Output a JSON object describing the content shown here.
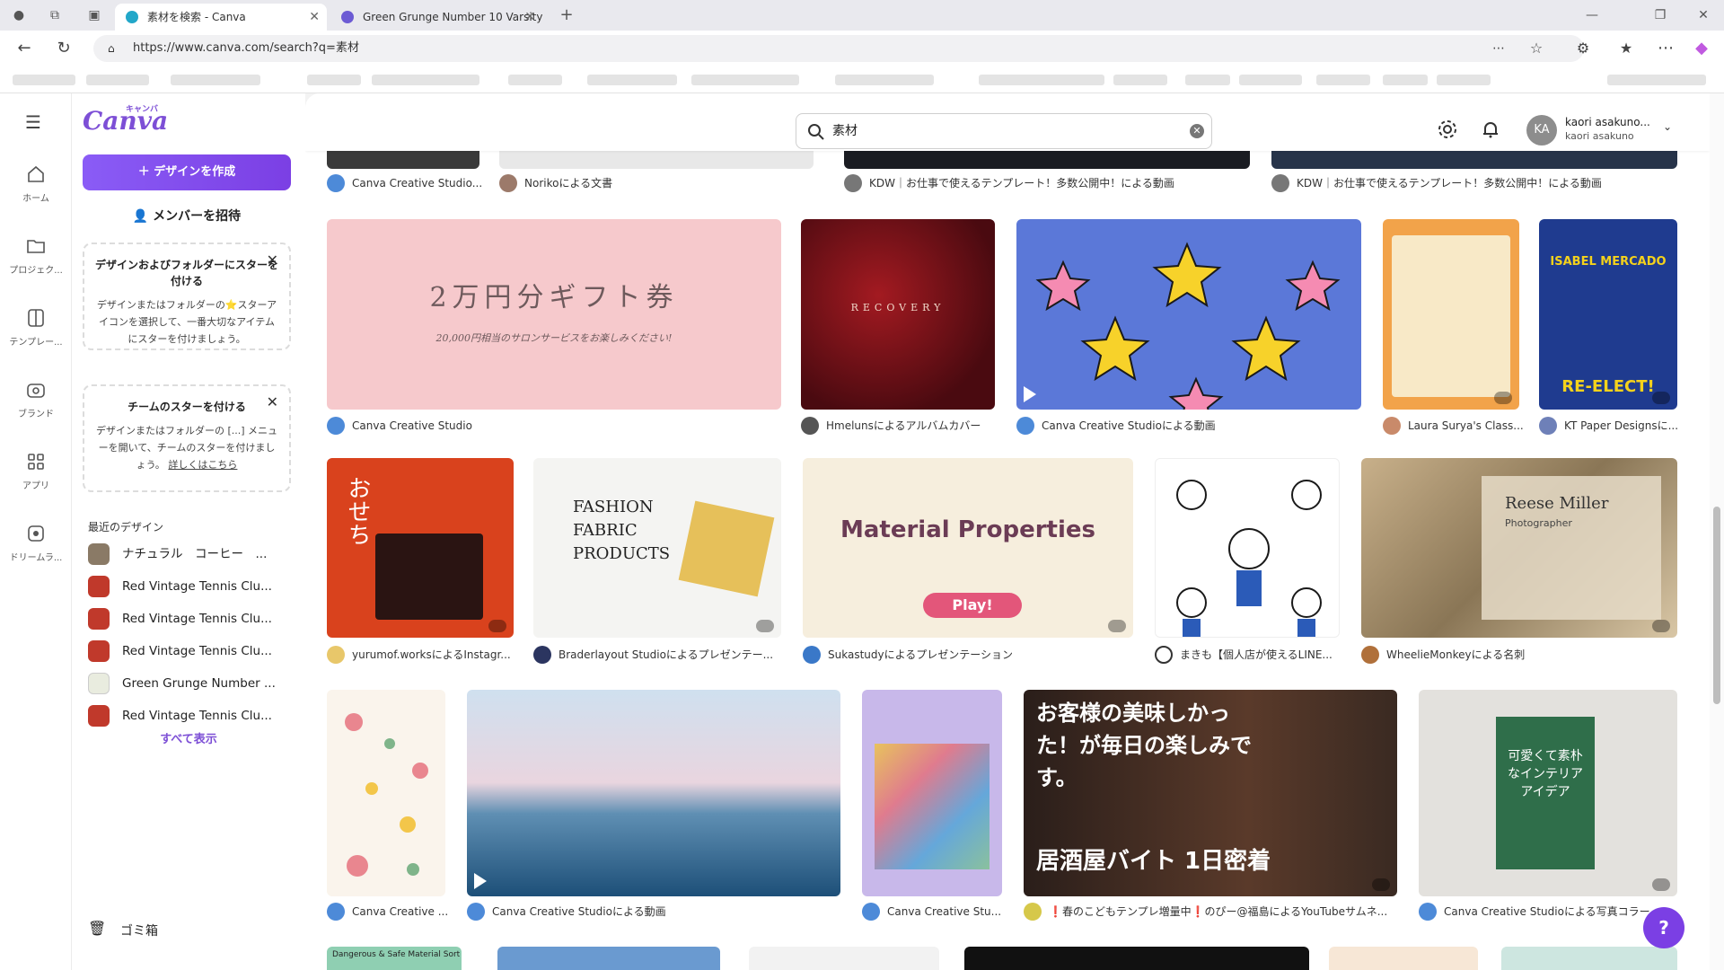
{
  "browser": {
    "tabs": [
      {
        "title": "素材を検索 - Canva",
        "active": true
      },
      {
        "title": "Green Grunge Number 10 Varsity",
        "active": false
      }
    ],
    "url": "https://www.canva.com/search?q=素材"
  },
  "rail": {
    "items": [
      {
        "label": "ホーム",
        "icon": "home-icon"
      },
      {
        "label": "プロジェク...",
        "icon": "folder-icon"
      },
      {
        "label": "テンプレー...",
        "icon": "template-icon"
      },
      {
        "label": "ブランド",
        "icon": "brand-icon"
      },
      {
        "label": "アプリ",
        "icon": "apps-icon"
      },
      {
        "label": "ドリームラ...",
        "icon": "dream-lab-icon"
      }
    ]
  },
  "panel": {
    "logo": "Canva",
    "logo_kana": "キャンバ",
    "create_button": "＋ デザインを作成",
    "invite_button": "メンバーを招待",
    "star_card": {
      "title": "デザインおよびフォルダーにスターを付ける",
      "body": "デザインまたはフォルダーの⭐スターアイコンを選択して、一番大切なアイテムにスターを付けましょう。"
    },
    "team_card": {
      "title": "チームのスターを付ける",
      "body": "デザインまたはフォルダーの [...] メニューを開いて、チームのスターを付けましょう。",
      "link": "詳しくはこちら"
    },
    "recent_title": "最近のデザイン",
    "recent": [
      "ナチュラル　コーヒー　...",
      "Red Vintage Tennis Clu...",
      "Red Vintage Tennis Clu...",
      "Red Vintage Tennis Clu...",
      "Green Grunge Number ...",
      "Red Vintage Tennis Clu..."
    ],
    "see_all": "すべて表示",
    "trash": "ゴミ箱"
  },
  "header": {
    "search_value": "素材",
    "user_name": "kaori asakuno...",
    "user_sub": "kaori asakuno",
    "avatar_initials": "KA"
  },
  "results": {
    "row0_captions": [
      "Canva Creative Studio...",
      "Norikoによる文書",
      "KDW｜お仕事で使えるテンプレート！多数公開中！による動画",
      "KDW｜お仕事で使えるテンプレート！多数公開中！による動画"
    ],
    "row1": [
      {
        "caption": "Canva Creative Studio",
        "text": "2万円分ギフト券",
        "sub": "20,000円相当のサロンサービスをお楽しみください!"
      },
      {
        "caption": "Hmelunsによるアルバムカバー",
        "text": "RECOVERY"
      },
      {
        "caption": "Canva Creative Studioによる動画"
      },
      {
        "caption": "Laura Surya's Class..."
      },
      {
        "caption": "KT Paper Designsに...",
        "text": "ISABEL MERCADO",
        "sub": "RE-ELECT!"
      }
    ],
    "row2": [
      {
        "caption": "yurumof.worksによるInstagr...",
        "text": "おせち"
      },
      {
        "caption": "Braderlayout Studioによるプレゼンテー...",
        "text": "FASHION FABRIC PRODUCTS"
      },
      {
        "caption": "Sukastudyによるプレゼンテーション",
        "text": "Material Properties",
        "sub": "Play!"
      },
      {
        "caption": "まきも【個人店が使えるLINE..."
      },
      {
        "caption": "WheelieMonkeyによる名刺",
        "text": "Reese Miller",
        "sub": "Photographer"
      }
    ],
    "row3": [
      {
        "caption": "Canva Creative ..."
      },
      {
        "caption": "Canva Creative Studioによる動画"
      },
      {
        "caption": "Canva Creative Stu..."
      },
      {
        "caption": "❗春のこどもテンプレ増量中❗のぴー@福島によるYouTubeサムネ...",
        "text": "お客様の美味しかった！が毎日の楽しみです。",
        "sub": "居酒屋バイト 1日密着"
      },
      {
        "caption": "Canva Creative Studioによる写真コラー...",
        "text": "可愛くて素朴なインテリアアイデア"
      }
    ],
    "row4_label": "Dangerous & Safe Material Sort"
  },
  "help_label": "?"
}
